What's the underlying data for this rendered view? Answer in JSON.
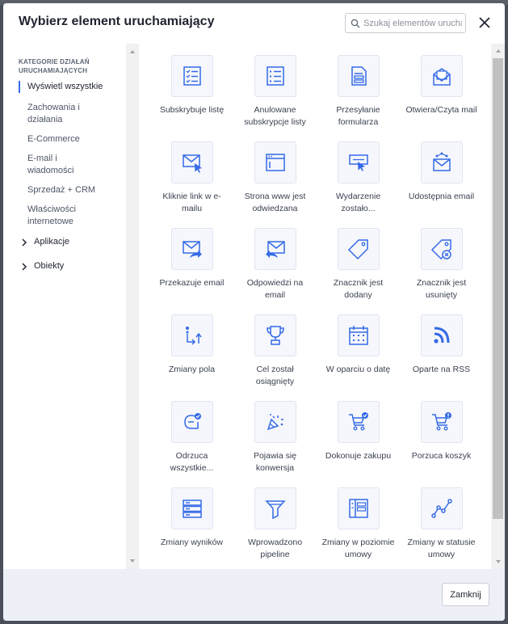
{
  "dialog": {
    "title": "Wybierz element uruchamiający",
    "search_placeholder": "Szukaj elementów uruchamiających",
    "close_label": "Zamknij"
  },
  "sidebar": {
    "heading": "KATEGORIE DZIAŁAŃ URUCHAMIAJĄCYCH",
    "items": [
      {
        "label": "Wyświetl wszystkie",
        "active": true
      },
      {
        "label": "Zachowania i działania"
      },
      {
        "label": "E-Commerce"
      },
      {
        "label": "E-mail i wiadomości"
      },
      {
        "label": "Sprzedaż + CRM"
      },
      {
        "label": "Właściwości internetowe"
      }
    ],
    "groups": [
      {
        "label": "Aplikacje"
      },
      {
        "label": "Obiekty"
      }
    ]
  },
  "triggers": [
    {
      "label": "Subskrybuje listę",
      "icon": "list-check-icon"
    },
    {
      "label": "Anulowane subskrypcje listy",
      "icon": "list-icon"
    },
    {
      "label": "Przesyłanie formularza",
      "icon": "form-document-icon"
    },
    {
      "label": "Otwiera/Czyta mail",
      "icon": "open-envelope-icon"
    },
    {
      "label": "Kliknie link w e-mailu",
      "icon": "email-click-icon"
    },
    {
      "label": "Strona www jest odwiedzana",
      "icon": "browser-window-icon"
    },
    {
      "label": "Wydarzenie zostało...",
      "icon": "event-click-icon"
    },
    {
      "label": "Udostępnia email",
      "icon": "share-email-icon"
    },
    {
      "label": "Przekazuje email",
      "icon": "forward-email-icon"
    },
    {
      "label": "Odpowiedzi na email",
      "icon": "reply-email-icon"
    },
    {
      "label": "Znacznik jest dodany",
      "icon": "tag-icon"
    },
    {
      "label": "Znacznik jest usunięty",
      "icon": "tag-remove-icon"
    },
    {
      "label": "Zmiany pola",
      "icon": "field-change-icon"
    },
    {
      "label": "Cel został osiągnięty",
      "icon": "trophy-icon"
    },
    {
      "label": "W oparciu o datę",
      "icon": "calendar-icon"
    },
    {
      "label": "Oparte na RSS",
      "icon": "rss-icon"
    },
    {
      "label": "Odrzuca wszystkie...",
      "icon": "reject-all-icon"
    },
    {
      "label": "Pojawia się konwersja",
      "icon": "conversion-icon"
    },
    {
      "label": "Dokonuje zakupu",
      "icon": "cart-check-icon"
    },
    {
      "label": "Porzuca koszyk",
      "icon": "cart-alert-icon"
    },
    {
      "label": "Zmiany wyników",
      "icon": "score-stack-icon"
    },
    {
      "label": "Wprowadzono pipeline",
      "icon": "funnel-icon"
    },
    {
      "label": "Zmiany w poziomie umowy",
      "icon": "deal-stage-icon"
    },
    {
      "label": "Zmiany w statusie umowy",
      "icon": "deal-status-icon"
    }
  ],
  "colors": {
    "accent": "#356ae6",
    "icon_stroke": "#356ae6",
    "tile_bg": "#f5f7fc",
    "footer_bg": "#eef0f8"
  }
}
